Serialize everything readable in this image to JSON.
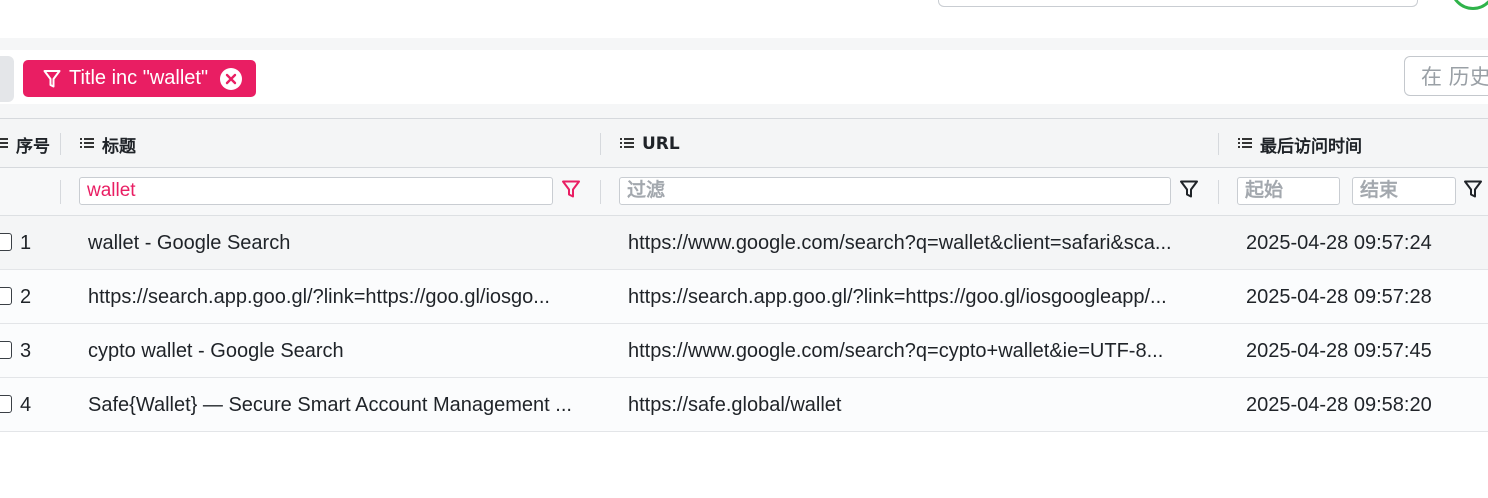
{
  "filter_bar": {
    "chip_label": "Title inc \"wallet\"",
    "search_placeholder": "在 历史"
  },
  "table": {
    "columns": [
      {
        "label": "序号"
      },
      {
        "label": "标题"
      },
      {
        "label": "URL"
      },
      {
        "label": "最后访问时间"
      }
    ],
    "filters": {
      "title_value": "wallet",
      "url_placeholder": "过滤",
      "time_start_placeholder": "起始",
      "time_end_placeholder": "结束"
    },
    "rows": [
      {
        "idx": "1",
        "title": "wallet - Google Search",
        "url": "https://www.google.com/search?q=wallet&client=safari&sca...",
        "time": "2025-04-28 09:57:24"
      },
      {
        "idx": "2",
        "title": "https://search.app.goo.gl/?link=https://goo.gl/iosgo...",
        "url": "https://search.app.goo.gl/?link=https://goo.gl/iosgoogleapp/...",
        "time": "2025-04-28 09:57:28"
      },
      {
        "idx": "3",
        "title": "cypto wallet - Google Search",
        "url": "https://www.google.com/search?q=cypto+wallet&ie=UTF-8...",
        "time": "2025-04-28 09:57:45"
      },
      {
        "idx": "4",
        "title": "Safe{Wallet} — Secure Smart Account Management ...",
        "url": "https://safe.global/wallet",
        "time": "2025-04-28 09:58:20"
      }
    ]
  },
  "colors": {
    "accent": "#e91e63",
    "status_ring": "#2fb34a"
  }
}
